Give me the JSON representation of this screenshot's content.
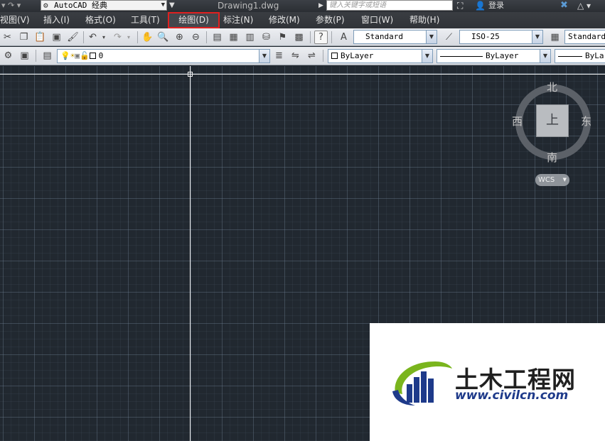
{
  "titlebar": {
    "workspace": "AutoCAD 经典",
    "document": "Drawing1.dwg",
    "search_placeholder": "键入关键字或短语",
    "login": "登录"
  },
  "menus": [
    {
      "label": "视图(V)",
      "selected": false
    },
    {
      "label": "插入(I)",
      "selected": false
    },
    {
      "label": "格式(O)",
      "selected": false
    },
    {
      "label": "工具(T)",
      "selected": false
    },
    {
      "label": "绘图(D)",
      "selected": true
    },
    {
      "label": "标注(N)",
      "selected": false
    },
    {
      "label": "修改(M)",
      "selected": false
    },
    {
      "label": "参数(P)",
      "selected": false
    },
    {
      "label": "窗口(W)",
      "selected": false
    },
    {
      "label": "帮助(H)",
      "selected": false
    }
  ],
  "styles": {
    "text_style": "Standard",
    "dim_style": "ISO-25",
    "table_style": "Standard"
  },
  "layers": {
    "current_layer": "0",
    "color": "ByLayer",
    "linetype": "ByLayer",
    "lineweight": "ByLa"
  },
  "viewcube": {
    "north": "北",
    "south": "南",
    "west": "西",
    "east": "东",
    "face": "上",
    "ucs": "WCS"
  },
  "watermark": {
    "name": "土木工程网",
    "url": "www.civilcn.com"
  },
  "colors": {
    "canvas": "#212830",
    "highlight": "#e02020",
    "logo_blue": "#1e3a8a",
    "logo_green": "#7ab51d"
  }
}
